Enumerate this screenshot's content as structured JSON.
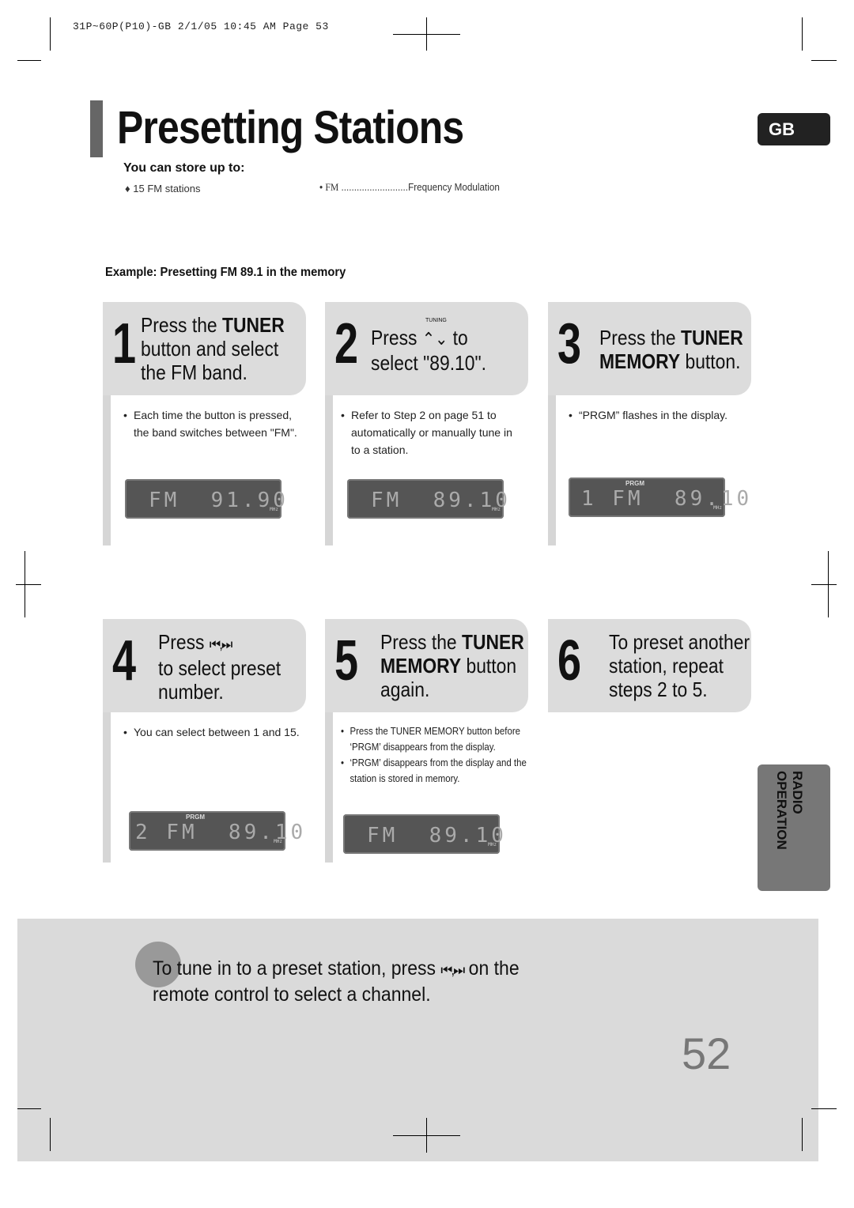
{
  "print_header": "31P~60P(P10)-GB  2/1/05 10:45 AM  Page 53",
  "title": "Presetting Stations",
  "lang_badge": "GB",
  "store": {
    "heading": "You can store up to:",
    "item": "15 FM stations",
    "abbr_term": "FM",
    "abbr_dots": "..........................",
    "abbr_def": "Frequency Modulation"
  },
  "example": "Example: Presetting FM 89.1 in the memory",
  "steps": [
    {
      "num": "1",
      "lines": [
        "Press the ",
        "TUNER",
        "button and select",
        "the FM band."
      ],
      "notes": [
        "Each time the button is pressed, the band switches between \"FM\"."
      ],
      "display": {
        "value": "FM  91.90",
        "prgm": "",
        "unit": "MHz"
      }
    },
    {
      "num": "2",
      "lines": [
        "Press",
        "to",
        "select \"89.10\"."
      ],
      "icon_label": "TUNING",
      "notes": [
        "Refer to Step 2 on page 51 to automatically or manually tune in to a station."
      ],
      "display": {
        "value": "FM  89.10",
        "prgm": "",
        "unit": "MHz"
      }
    },
    {
      "num": "3",
      "lines": [
        "Press the ",
        "TUNER",
        "MEMORY",
        " button."
      ],
      "notes": [
        "“PRGM” flashes in the display."
      ],
      "display": {
        "value": "1 FM  89.10",
        "prgm": "PRGM",
        "unit": "MHz"
      }
    },
    {
      "num": "4",
      "lines": [
        "Press",
        "to select preset",
        "number."
      ],
      "notes": [
        "You can select between 1 and 15."
      ],
      "display": {
        "value": "2 FM  89.10",
        "prgm": "PRGM",
        "unit": "MHz"
      }
    },
    {
      "num": "5",
      "lines": [
        "Press the ",
        "TUNER",
        "MEMORY",
        " button",
        "again."
      ],
      "notes": [
        "Press the TUNER MEMORY button before ‘PRGM’ disappears from the display.",
        "‘PRGM’ disappears from the display and the station is stored in memory."
      ],
      "display": {
        "value": "FM  89.10",
        "prgm": "",
        "unit": "MHz"
      }
    },
    {
      "num": "6",
      "lines": [
        "To preset another",
        "station, repeat",
        "steps 2 to 5."
      ],
      "notes": []
    }
  ],
  "side_tab": "RADIO OPERATION",
  "bottom_note": {
    "part1": "To tune in to a preset station, press",
    "part2": "on the",
    "part3": "remote control to select a channel."
  },
  "page_number": "52",
  "colors": {
    "card_header": "#dcdcdc",
    "lcd": "#555555",
    "badge": "#222222",
    "side_tab": "#777777",
    "bottom_band": "#dadada"
  }
}
